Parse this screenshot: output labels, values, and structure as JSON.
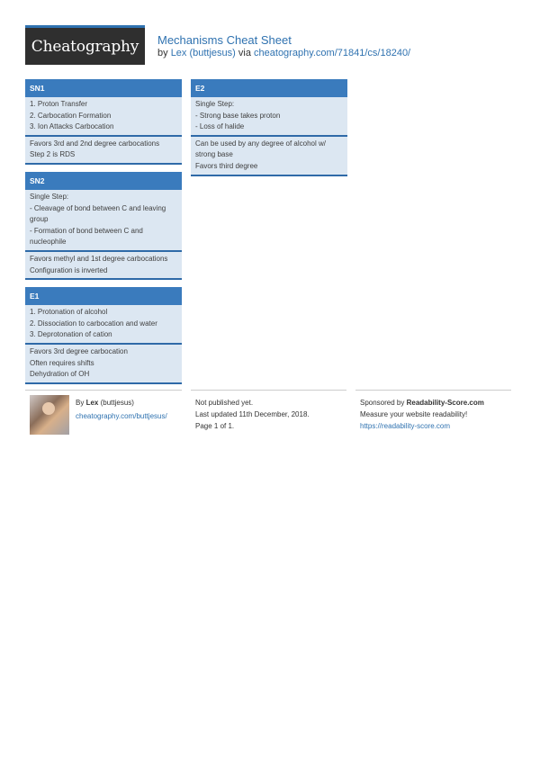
{
  "header": {
    "logo_text": "Cheatography",
    "title": "Mechanisms Cheat Sheet",
    "by_prefix": "by",
    "author": "Lex (buttjesus)",
    "via": "via",
    "url": "cheatography.com/71841/cs/18240/"
  },
  "colors": {
    "accent": "#3a7bbd",
    "box_bg": "#dce7f2",
    "logo_bg": "#2f2f2f",
    "link": "#2f72b0"
  },
  "boxes": {
    "sn1": {
      "title": "SN1",
      "sections": [
        [
          "1. Proton Transfer",
          "2. Carbocation Formation",
          "3. Ion Attacks Carbocation"
        ],
        [
          "Favors 3rd and 2nd degree carbocations",
          "Step 2 is RDS"
        ]
      ]
    },
    "sn2": {
      "title": "SN2",
      "sections": [
        [
          "Single Step:",
          "- Cleavage of bond between C and leaving group",
          "- Formation of bond between C and nucleophile"
        ],
        [
          "Favors methyl and 1st degree carbocations",
          "Configuration is inverted"
        ]
      ]
    },
    "e1": {
      "title": "E1",
      "sections": [
        [
          "1. Protonation of alcohol",
          "2. Dissociation to carbocation and water",
          "3. Deprotonation of cation"
        ],
        [
          "Favors 3rd degree carbocation",
          "Often requires shifts",
          "Dehydration of OH"
        ]
      ]
    },
    "e2": {
      "title": "E2",
      "sections": [
        [
          "Single Step:",
          "- Strong base takes proton",
          "- Loss of halide"
        ],
        [
          "Can be used by any degree of alcohol w/ strong base",
          "Favors third degree"
        ]
      ]
    }
  },
  "footer": {
    "author": {
      "by": "By",
      "name": "Lex",
      "handle": "(buttjesus)",
      "link": "cheatography.com/buttjesus/"
    },
    "meta": {
      "published": "Not published yet.",
      "updated": "Last updated 11th December, 2018.",
      "page": "Page 1 of 1."
    },
    "sponsor": {
      "prefix": "Sponsored by",
      "name": "Readability-Score.com",
      "tagline": "Measure your website readability!",
      "link": "https://readability-score.com"
    }
  }
}
